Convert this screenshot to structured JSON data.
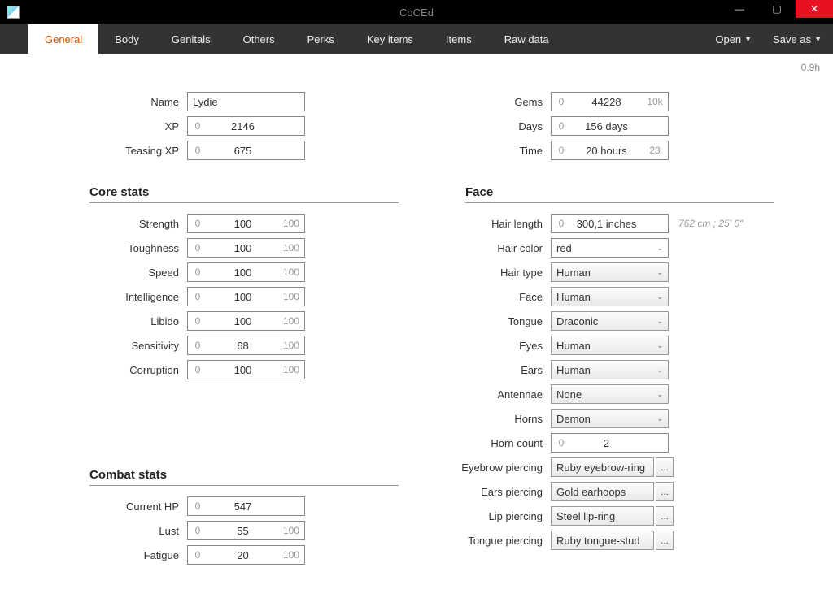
{
  "window": {
    "title": "CoCEd"
  },
  "tabs": [
    "General",
    "Body",
    "Genitals",
    "Others",
    "Perks",
    "Key items",
    "Items",
    "Raw data"
  ],
  "menus": {
    "open": "Open",
    "saveas": "Save as"
  },
  "version": "0.9h",
  "basic": {
    "name_label": "Name",
    "name": "Lydie",
    "xp_label": "XP",
    "xp": "2146",
    "xp_lo": "0",
    "txp_label": "Teasing XP",
    "txp": "675",
    "txp_lo": "0",
    "gems_label": "Gems",
    "gems": "44228",
    "gems_lo": "0",
    "gems_hi": "10k",
    "days_label": "Days",
    "days": "156 days",
    "days_lo": "0",
    "time_label": "Time",
    "time": "20 hours",
    "time_lo": "0",
    "time_hi": "23"
  },
  "core": {
    "header": "Core stats",
    "rows": [
      {
        "label": "Strength",
        "lo": "0",
        "val": "100",
        "hi": "100"
      },
      {
        "label": "Toughness",
        "lo": "0",
        "val": "100",
        "hi": "100"
      },
      {
        "label": "Speed",
        "lo": "0",
        "val": "100",
        "hi": "100"
      },
      {
        "label": "Intelligence",
        "lo": "0",
        "val": "100",
        "hi": "100"
      },
      {
        "label": "Libido",
        "lo": "0",
        "val": "100",
        "hi": "100"
      },
      {
        "label": "Sensitivity",
        "lo": "0",
        "val": "68",
        "hi": "100"
      },
      {
        "label": "Corruption",
        "lo": "0",
        "val": "100",
        "hi": "100"
      }
    ]
  },
  "combat": {
    "header": "Combat stats",
    "rows": [
      {
        "label": "Current HP",
        "lo": "0",
        "val": "547",
        "hi": ""
      },
      {
        "label": "Lust",
        "lo": "0",
        "val": "55",
        "hi": "100"
      },
      {
        "label": "Fatigue",
        "lo": "0",
        "val": "20",
        "hi": "100"
      }
    ]
  },
  "face": {
    "header": "Face",
    "hairlen_label": "Hair length",
    "hairlen": "300,1 inches",
    "hairlen_lo": "0",
    "hairlen_hint": "762 cm ; 25' 0\"",
    "haircolor_label": "Hair color",
    "haircolor": "red",
    "hairtype_label": "Hair type",
    "hairtype": "Human",
    "face_label": "Face",
    "face": "Human",
    "tongue_label": "Tongue",
    "tongue": "Draconic",
    "eyes_label": "Eyes",
    "eyes": "Human",
    "ears_label": "Ears",
    "ears": "Human",
    "antennae_label": "Antennae",
    "antennae": "None",
    "horns_label": "Horns",
    "horns": "Demon",
    "horncount_label": "Horn count",
    "horncount": "2",
    "horncount_lo": "0",
    "eyebrow_label": "Eyebrow piercing",
    "eyebrow": "Ruby eyebrow-ring",
    "earsp_label": "Ears piercing",
    "earsp": "Gold earhoops",
    "lip_label": "Lip piercing",
    "lip": "Steel lip-ring",
    "tonguep_label": "Tongue piercing",
    "tonguep": "Ruby tongue-stud",
    "more": "..."
  }
}
